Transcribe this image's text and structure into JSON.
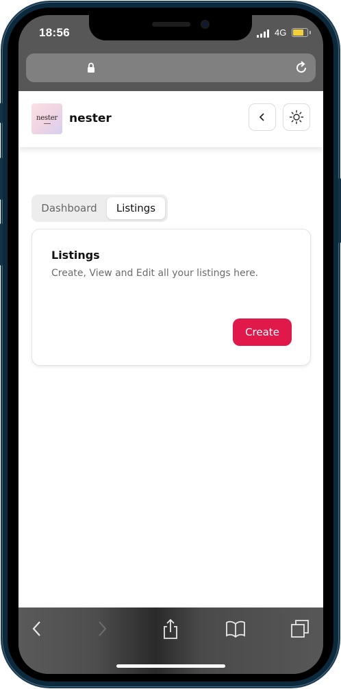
{
  "status_bar": {
    "time": "18:56",
    "network": "4G",
    "battery_color": "#f2d03b"
  },
  "app": {
    "brand": "nester",
    "logo_text": "nester"
  },
  "tabs": [
    {
      "label": "Dashboard",
      "active": false
    },
    {
      "label": "Listings",
      "active": true
    }
  ],
  "card": {
    "title": "Listings",
    "description": "Create, View and Edit all your listings here.",
    "create_label": "Create"
  },
  "colors": {
    "accent": "#e0194a"
  },
  "icons": {
    "url_lock": "lock-icon",
    "url_reload": "reload-icon",
    "header_back": "chevron-left-icon",
    "header_theme": "sun-icon",
    "toolbar": [
      "back-arrow-icon",
      "forward-arrow-icon",
      "share-icon",
      "bookmarks-icon",
      "tabs-icon"
    ]
  }
}
